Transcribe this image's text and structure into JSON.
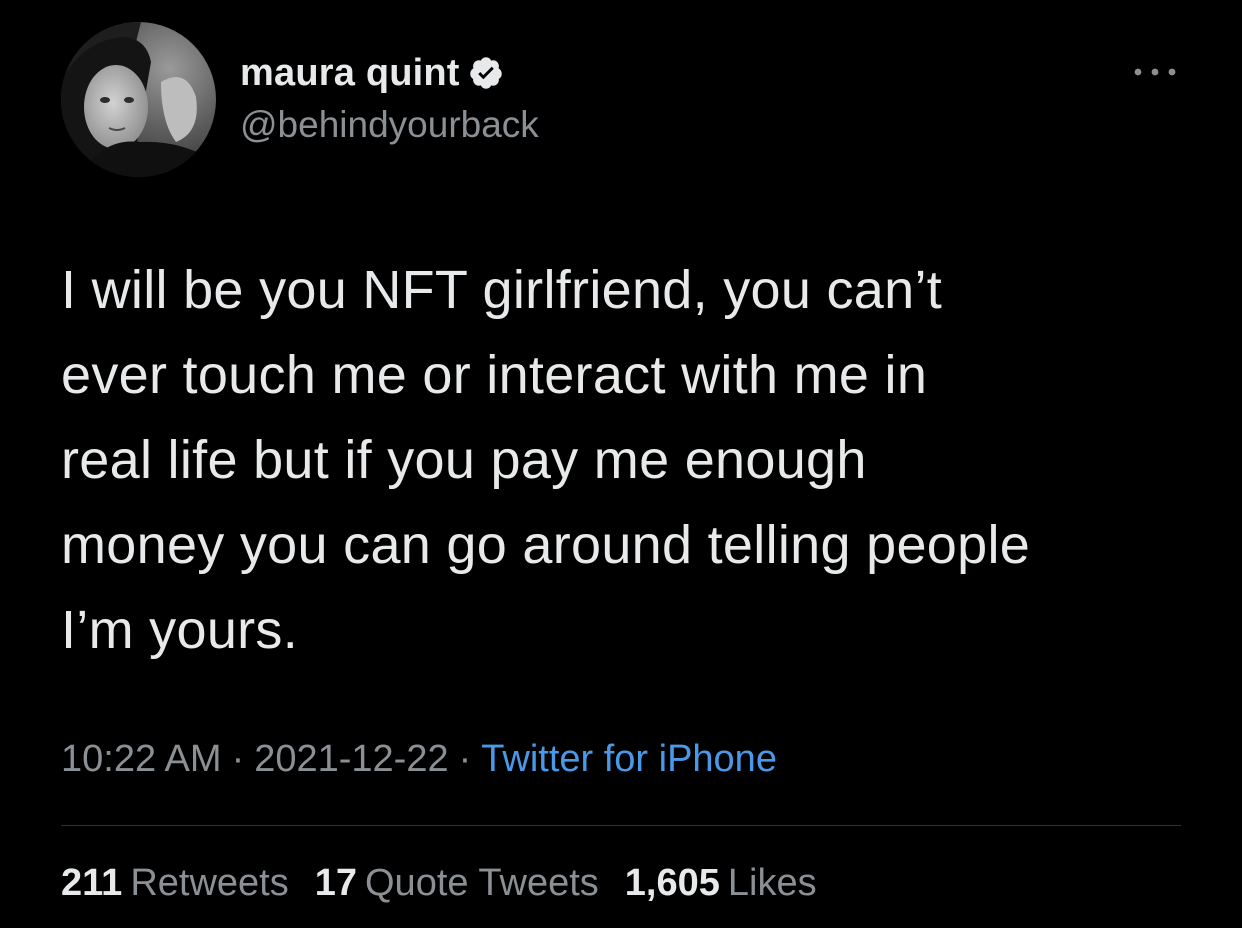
{
  "author": {
    "display_name": "maura quint",
    "handle": "@behindyourback",
    "verified": true,
    "avatar_icon": "profile-photo"
  },
  "tweet": {
    "lines": [
      "I will be you NFT girlfriend, you can’t",
      "ever touch me or interact with me in",
      "real life but if you pay me enough",
      "money you can go around telling people",
      "I’m yours."
    ],
    "time": "10:22 AM",
    "separator": "·",
    "date": "2021-12-22",
    "source": "Twitter for iPhone"
  },
  "stats": {
    "retweets": {
      "count": "211",
      "label": "Retweets"
    },
    "quote_tweets": {
      "count": "17",
      "label": "Quote Tweets"
    },
    "likes": {
      "count": "1,605",
      "label": "Likes"
    }
  },
  "icons": {
    "more": "more-horizontal-icon",
    "verified": "verified-badge-icon"
  },
  "colors": {
    "background": "#000000",
    "text": "#e7e9ea",
    "muted": "#8b9095",
    "link": "#4a99e9",
    "divider": "#2f3336"
  }
}
